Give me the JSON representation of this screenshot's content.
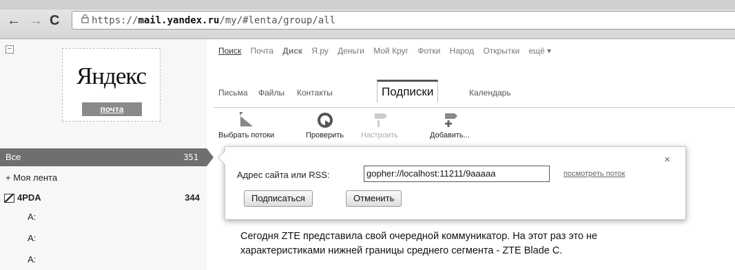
{
  "browser": {
    "nav": {
      "back": "←",
      "forward": "→",
      "reload": "C"
    },
    "url": {
      "scheme": "https://",
      "host": "mail.yandex.ru",
      "path": "/my/#lenta/group/all"
    }
  },
  "logo": {
    "text": "Яндекс",
    "badge": "почта"
  },
  "sidebar": {
    "collapse": "−",
    "all": {
      "label": "Все",
      "count": "351"
    },
    "my_feed": "+ Моя лента",
    "group": {
      "label": "4PDA",
      "count": "344"
    },
    "items": [
      "A:",
      "A:",
      "A:"
    ]
  },
  "services": [
    "Поиск",
    "Почта",
    "Диск",
    "Я.ру",
    "Деньги",
    "Мой Круг",
    "Фотки",
    "Народ",
    "Открытки",
    "ещё ▾"
  ],
  "mail_tabs": [
    "Письма",
    "Файлы",
    "Контакты",
    "Подписки",
    "Календарь"
  ],
  "toolbar": [
    "Выбрать потоки",
    "Проверить",
    "Настроить",
    "Добавить..."
  ],
  "popup": {
    "label": "Адрес сайта или RSS:",
    "input_value": "gopher://localhost:11211/9aaaaa",
    "preview_link": "посмотреть поток",
    "close": "×",
    "subscribe_button": "Подписаться",
    "cancel_button": "Отменить"
  },
  "article": {
    "line1": "Сегодня ZTE представила свой очередной коммуникатор. На этот раз это не",
    "line2": "характеристиками нижней границы среднего сегмента - ZTE Blade C."
  }
}
